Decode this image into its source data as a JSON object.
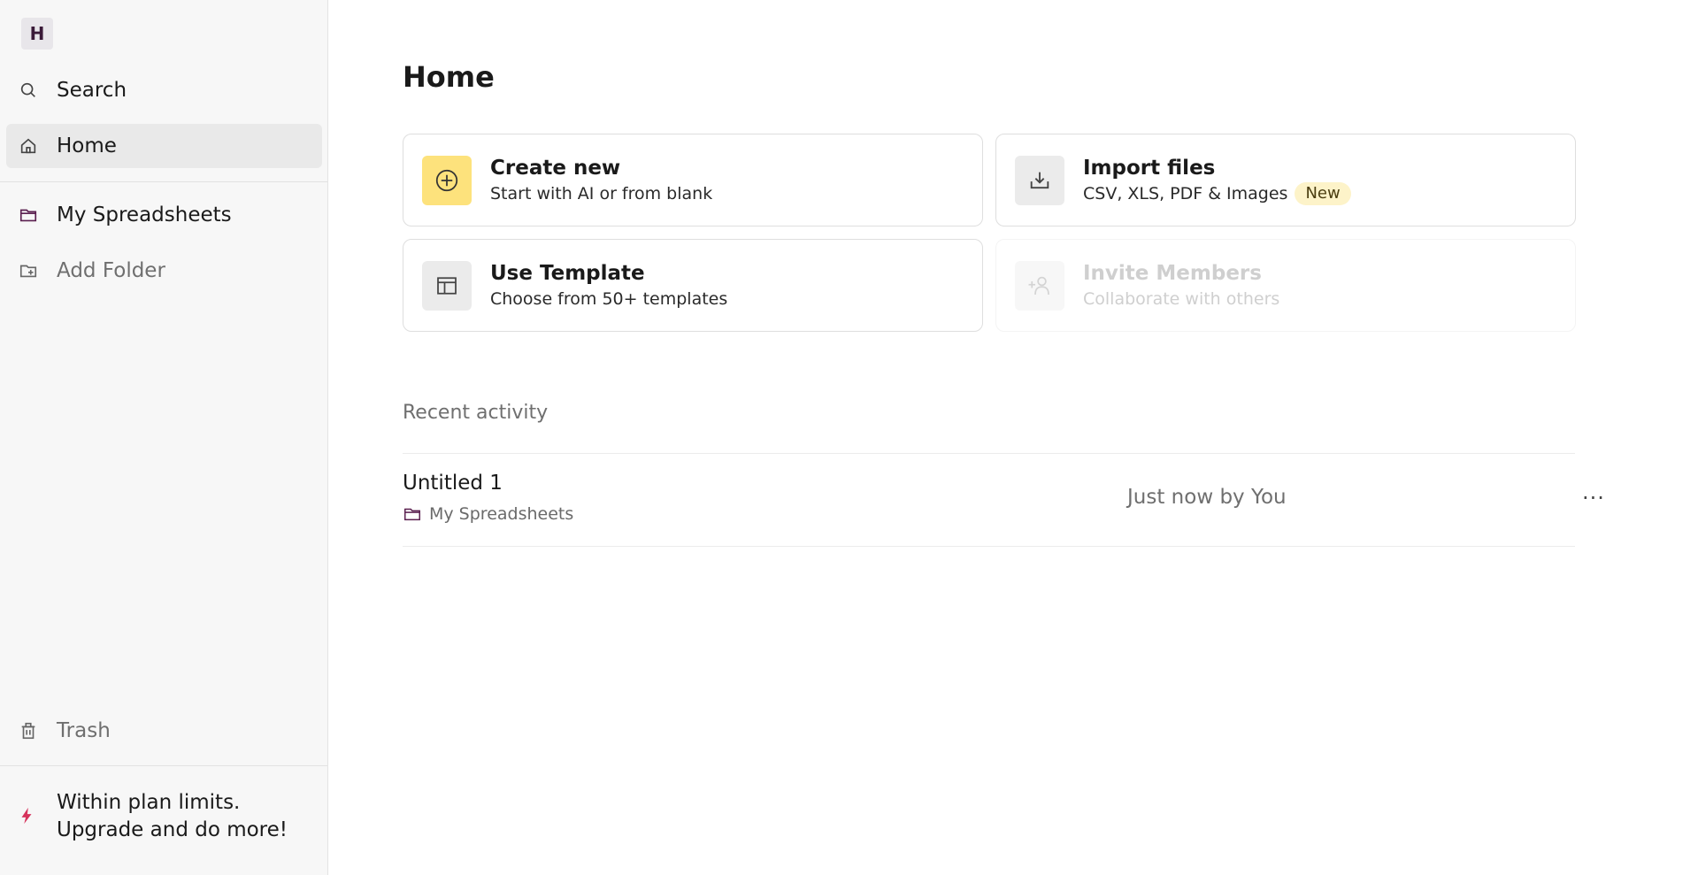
{
  "app": {
    "logo_letter": "H"
  },
  "sidebar": {
    "search_label": "Search",
    "home_label": "Home",
    "my_spreadsheets_label": "My Spreadsheets",
    "add_folder_label": "Add Folder",
    "trash_label": "Trash",
    "upgrade_line1": "Within plan limits.",
    "upgrade_line2": "Upgrade and do more!"
  },
  "main": {
    "title": "Home",
    "cards": [
      {
        "title": "Create new",
        "subtitle": "Start with AI or from blank",
        "icon": "plus-circle-icon"
      },
      {
        "title": "Import files",
        "subtitle": "CSV, XLS, PDF & Images",
        "badge": "New",
        "icon": "download-tray-icon"
      },
      {
        "title": "Use Template",
        "subtitle": "Choose from 50+ templates",
        "icon": "template-layout-icon"
      },
      {
        "title": "Invite Members",
        "subtitle": "Collaborate with others",
        "icon": "add-user-icon",
        "disabled": true
      }
    ],
    "recent_label": "Recent activity",
    "recent": [
      {
        "name": "Untitled 1",
        "folder": "My Spreadsheets",
        "time": "Just now by You",
        "more": "···"
      }
    ]
  },
  "colors": {
    "accent_yellow": "#fde27c",
    "badge_bg": "#fdf3c9",
    "upgrade_bolt": "#d6335c",
    "folder_icon": "#5a1f4f"
  }
}
